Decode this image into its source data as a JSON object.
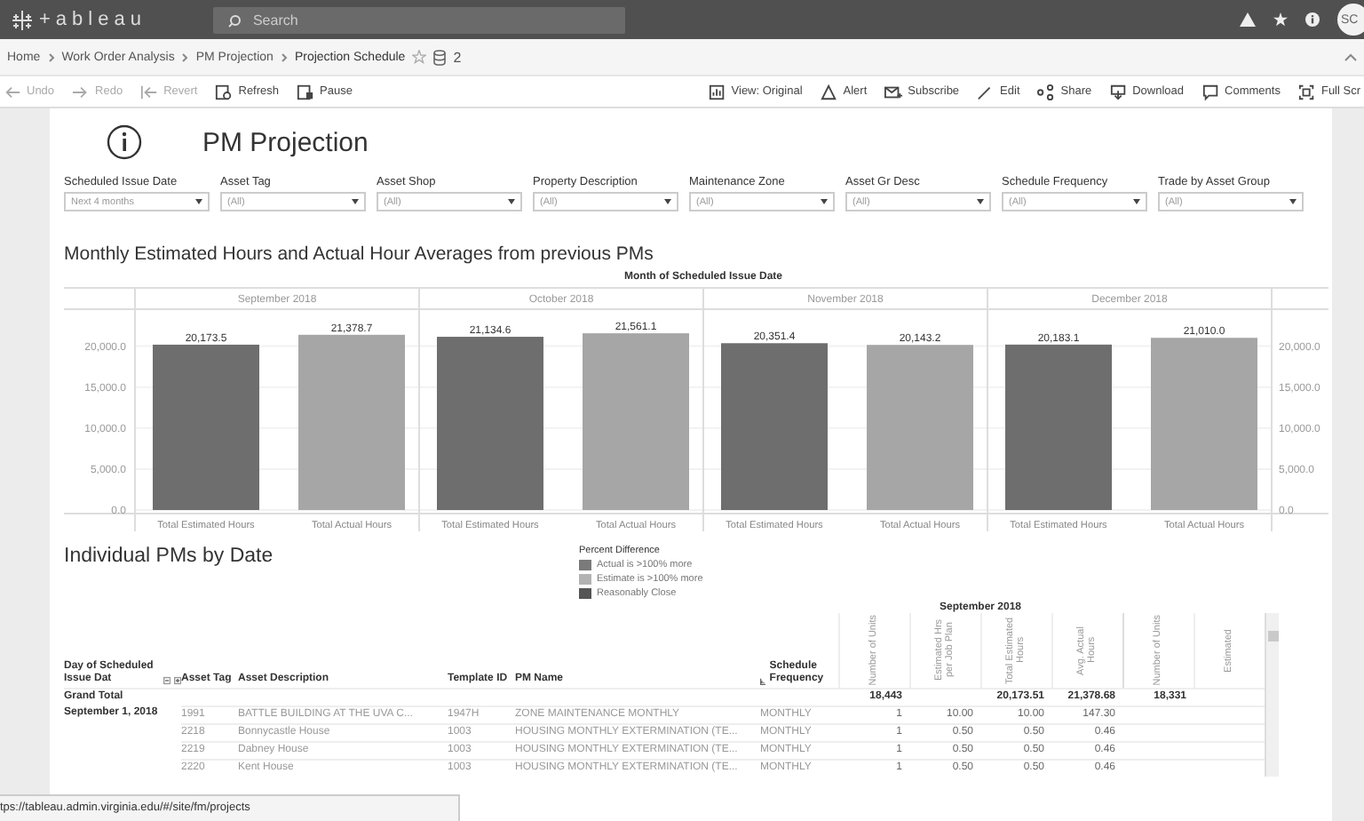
{
  "top_bar": {
    "logo": "+ableau",
    "search": {
      "placeholder": "Search"
    },
    "avatar": "SC"
  },
  "breadcrumb": {
    "items": [
      "Home",
      "Work Order Analysis",
      "PM Projection",
      "Projection Schedule"
    ],
    "data_source_count": "2"
  },
  "toolbar": {
    "left": [
      {
        "kind": "undo",
        "label": "Undo",
        "disabled": true
      },
      {
        "kind": "redo",
        "label": "Redo",
        "disabled": true
      },
      {
        "kind": "revert",
        "label": "Revert",
        "disabled": true
      },
      {
        "kind": "refresh",
        "label": "Refresh",
        "disabled": false
      },
      {
        "kind": "pause",
        "label": "Pause",
        "disabled": false
      }
    ],
    "right": [
      {
        "kind": "view",
        "label": "View: Original",
        "disabled": false
      },
      {
        "kind": "alert",
        "label": "Alert",
        "disabled": false
      },
      {
        "kind": "subscribe",
        "label": "Subscribe",
        "disabled": false
      },
      {
        "kind": "edit",
        "label": "Edit",
        "disabled": false
      },
      {
        "kind": "share",
        "label": "Share",
        "disabled": false
      },
      {
        "kind": "download",
        "label": "Download",
        "disabled": false
      },
      {
        "kind": "comments",
        "label": "Comments",
        "disabled": false
      },
      {
        "kind": "fullscreen",
        "label": "Full Scr",
        "disabled": false
      }
    ]
  },
  "dashboard": {
    "title": "PM Projection",
    "filters": [
      {
        "label": "Scheduled Issue Date",
        "value": "Next 4 months"
      },
      {
        "label": "Asset Tag",
        "value": "(All)"
      },
      {
        "label": "Asset Shop",
        "value": "(All)"
      },
      {
        "label": "Property Description",
        "value": "(All)"
      },
      {
        "label": "Maintenance Zone",
        "value": "(All)"
      },
      {
        "label": "Asset Gr Desc",
        "value": "(All)"
      },
      {
        "label": "Schedule Frequency",
        "value": "(All)"
      },
      {
        "label": "Trade by Asset Group",
        "value": "(All)"
      }
    ],
    "chart": {
      "title": "Monthly Estimated Hours and Actual Hour Averages from previous PMs",
      "header": "Month of Scheduled Issue Date",
      "chart_data": {
        "type": "bar",
        "categories": [
          "September 2018",
          "October 2018",
          "November 2018",
          "December 2018"
        ],
        "series": [
          {
            "name": "Total Estimated Hours",
            "color": "#6e6e6e",
            "values": [
              20173.5,
              21134.6,
              20351.4,
              20183.1
            ],
            "value_labels": [
              "20,173.5",
              "21,134.6",
              "20,351.4",
              "20,183.1"
            ]
          },
          {
            "name": "Total Actual Hours",
            "color": "#a6a6a6",
            "values": [
              21378.7,
              21561.1,
              20143.2,
              21010.0
            ],
            "value_labels": [
              "21,378.7",
              "21,561.1",
              "20,143.2",
              "21,010.0"
            ]
          }
        ],
        "grid": true,
        "ylim": [
          0,
          24500
        ],
        "yticks": [
          {
            "value": 0,
            "label": "0.0"
          },
          {
            "value": 5000,
            "label": "5,000.0"
          },
          {
            "value": 10000,
            "label": "10,000.0"
          },
          {
            "value": 15000,
            "label": "15,000.0"
          },
          {
            "value": 20000,
            "label": "20,000.0"
          }
        ]
      }
    },
    "table": {
      "title": "Individual PMs by Date",
      "legend": {
        "title": "Percent Difference",
        "items": [
          {
            "label": "Actual is >100% more",
            "color": "#7a7a7a"
          },
          {
            "label": "Estimate is >100% more",
            "color": "#b3b3b3"
          },
          {
            "label": "Reasonably Close",
            "color": "#555555"
          }
        ]
      },
      "columns": [
        "Day of Scheduled Issue Dat",
        "Asset Tag",
        "Asset Description",
        "Template ID",
        "PM Name",
        "Schedule Frequency"
      ],
      "group_header": "September 2018",
      "measure_columns": [
        "Number of Units",
        "Estimated Hrs per Job Plan",
        "Total Estimated Hours",
        "Avg. Actual Hours",
        "Number of Units",
        "Estimated"
      ],
      "grand_total": {
        "label": "Grand Total",
        "values": [
          {
            "text": "18,443"
          },
          {
            "empty": true
          },
          {
            "text": "20,173.51"
          },
          {
            "text": "21,378.68"
          },
          {
            "text": "18,331"
          }
        ]
      },
      "rows": [
        {
          "cells": [
            "September 1, 2018",
            "1991",
            "BATTLE BUILDING AT THE UVA C...",
            "1947H",
            "ZONE MAINTENANCE MONTHLY",
            "MONTHLY"
          ],
          "values": [
            "1",
            "10.00",
            "10.00",
            "147.30"
          ]
        },
        {
          "cells": [
            "",
            "2218",
            "Bonnycastle House",
            "1003",
            "HOUSING MONTHLY EXTERMINATION (TE...",
            "MONTHLY"
          ],
          "values": [
            "1",
            "0.50",
            "0.50",
            "0.46"
          ]
        },
        {
          "cells": [
            "",
            "2219",
            "Dabney House",
            "1003",
            "HOUSING MONTHLY EXTERMINATION (TE...",
            "MONTHLY"
          ],
          "values": [
            "1",
            "0.50",
            "0.50",
            "0.46"
          ]
        },
        {
          "cells": [
            "",
            "2220",
            "Kent House",
            "1003",
            "HOUSING MONTHLY EXTERMINATION (TE...",
            "MONTHLY"
          ],
          "values": [
            "1",
            "0.50",
            "0.50",
            "0.46"
          ]
        }
      ]
    }
  },
  "status_bar": {
    "url": "tps://tableau.admin.virginia.edu/#/site/fm/projects"
  }
}
